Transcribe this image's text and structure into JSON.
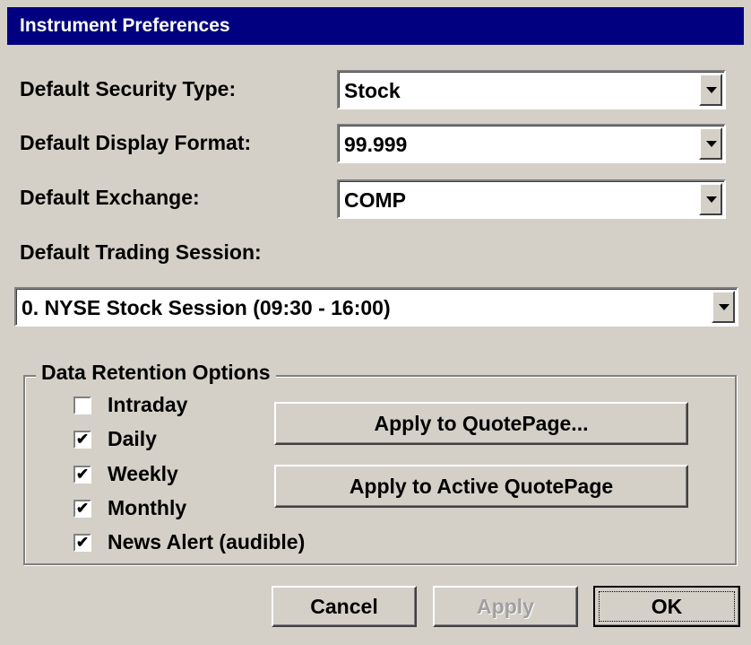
{
  "window": {
    "title": "Instrument Preferences"
  },
  "fields": {
    "security_type": {
      "label": "Default Security Type:",
      "value": "Stock"
    },
    "display_format": {
      "label": "Default Display Format:",
      "value": "99.999"
    },
    "exchange": {
      "label": "Default Exchange:",
      "value": "COMP"
    },
    "trading_session": {
      "label": "Default Trading Session:",
      "value": "0. NYSE Stock Session (09:30 - 16:00)"
    }
  },
  "retention": {
    "title": "Data Retention Options",
    "options": [
      {
        "label": "Intraday",
        "checked": false,
        "mark": ""
      },
      {
        "label": "Daily",
        "checked": true,
        "mark": "✔"
      },
      {
        "label": "Weekly",
        "checked": true,
        "mark": "✔"
      },
      {
        "label": "Monthly",
        "checked": true,
        "mark": "✔"
      },
      {
        "label": "News Alert (audible)",
        "checked": true,
        "mark": "✔"
      }
    ],
    "apply_quotepage_label": "Apply to QuotePage...",
    "apply_active_label": "Apply to Active QuotePage"
  },
  "buttons": {
    "cancel": "Cancel",
    "apply": "Apply",
    "ok": "OK"
  },
  "colors": {
    "titlebar": "#000080",
    "face": "#d4d0c8",
    "disabled_text": "#a0a0a0"
  }
}
